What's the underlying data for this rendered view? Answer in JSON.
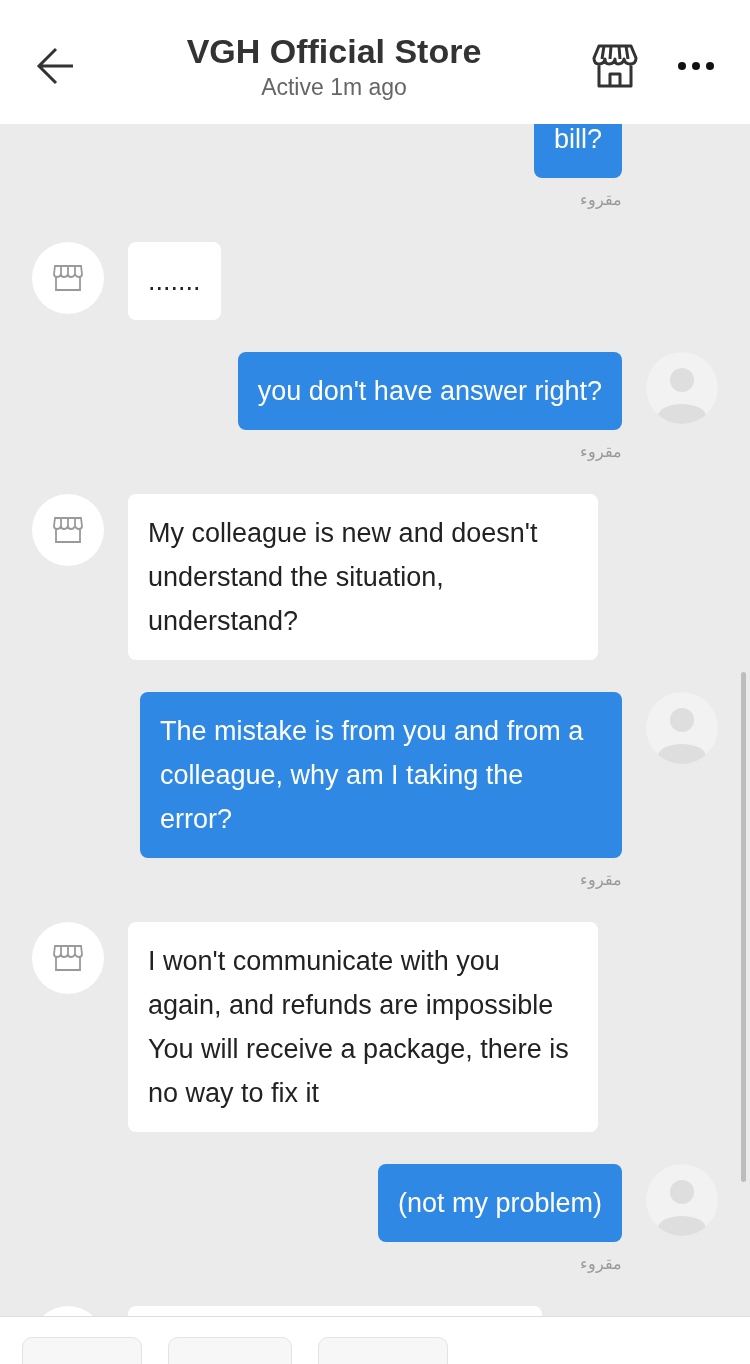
{
  "header": {
    "title": "VGH Official Store",
    "subtitle": "Active 1m ago"
  },
  "messages": [
    {
      "kind": "me",
      "text": "bill?",
      "receipt": "مقروء",
      "avatar": false
    },
    {
      "kind": "store",
      "text": "......."
    },
    {
      "kind": "me",
      "text": "you don't have answer right?",
      "receipt": "مقروء",
      "avatar": true
    },
    {
      "kind": "store",
      "text": "My colleague is new and doesn't understand the situation, understand?"
    },
    {
      "kind": "me",
      "text": "The mistake is from you and from a colleague, why am I taking the error?",
      "receipt": "مقروء",
      "avatar": true
    },
    {
      "kind": "store",
      "text": "I won't communicate with you again, and refunds are impossible\nYou will receive a package, there is no way to fix it"
    },
    {
      "kind": "me",
      "text": "(not my problem)",
      "receipt": "مقروء",
      "avatar": true
    },
    {
      "kind": "store"
    }
  ]
}
